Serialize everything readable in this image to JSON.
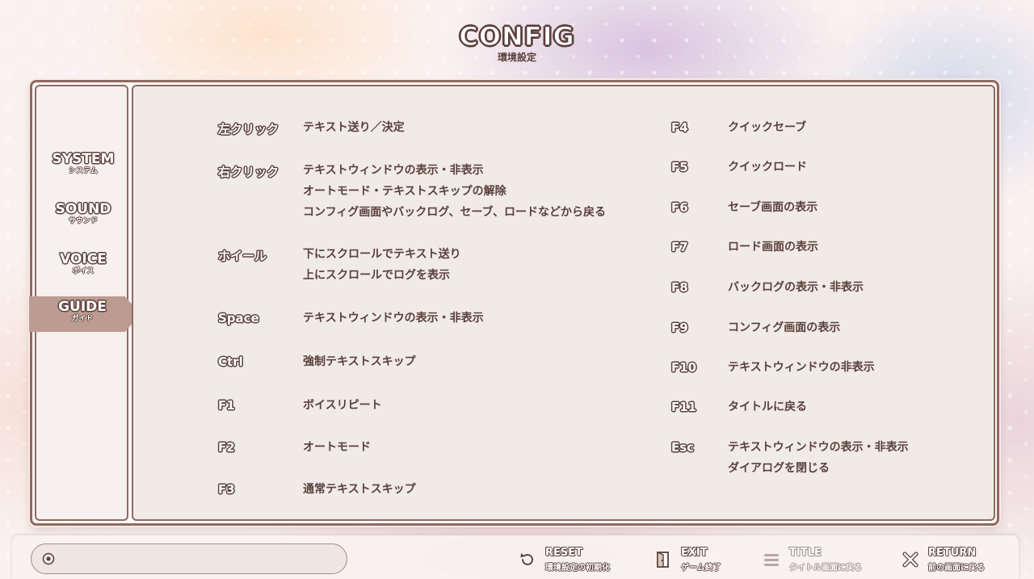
{
  "header": {
    "title": "CONFIG",
    "subtitle": "環境設定"
  },
  "sidebar": {
    "items": [
      {
        "label": "SYSTEM",
        "sub": "システム",
        "active": false
      },
      {
        "label": "SOUND",
        "sub": "サウンド",
        "active": false
      },
      {
        "label": "VOICE",
        "sub": "ボイス",
        "active": false
      },
      {
        "label": "GUIDE",
        "sub": "ガイド",
        "active": true
      }
    ]
  },
  "guide": {
    "left": [
      {
        "key": "左クリック",
        "lines": [
          "テキスト送り／決定"
        ]
      },
      {
        "key": "右クリック",
        "lines": [
          "テキストウィンドウの表示・非表示",
          "オートモード・テキストスキップの解除",
          "コンフィグ画面やバックログ、セーブ、ロードなどから戻る"
        ]
      },
      {
        "key": "ホイール",
        "lines": [
          "下にスクロールでテキスト送り",
          "上にスクロールでログを表示"
        ]
      },
      {
        "key": "Space",
        "lines": [
          "テキストウィンドウの表示・非表示"
        ]
      },
      {
        "key": "Ctrl",
        "lines": [
          "強制テキストスキップ"
        ]
      },
      {
        "key": "F1",
        "lines": [
          "ボイスリピート"
        ]
      },
      {
        "key": "F2",
        "lines": [
          "オートモード"
        ]
      },
      {
        "key": "F3",
        "lines": [
          "通常テキストスキップ"
        ]
      }
    ],
    "right": [
      {
        "key": "F4",
        "lines": [
          "クイックセーブ"
        ]
      },
      {
        "key": "F5",
        "lines": [
          "クイックロード"
        ]
      },
      {
        "key": "F6",
        "lines": [
          "セーブ画面の表示"
        ]
      },
      {
        "key": "F7",
        "lines": [
          "ロード画面の表示"
        ]
      },
      {
        "key": "F8",
        "lines": [
          "バックログの表示・非表示"
        ]
      },
      {
        "key": "F9",
        "lines": [
          "コンフィグ画面の表示"
        ]
      },
      {
        "key": "F10",
        "lines": [
          "テキストウィンドウの非表示"
        ]
      },
      {
        "key": "F11",
        "lines": [
          "タイトルに戻る"
        ]
      },
      {
        "key": "Esc",
        "lines": [
          "テキストウィンドウの表示・非表示",
          "ダイアログを閉じる"
        ]
      }
    ]
  },
  "bottom": {
    "reset": {
      "label": "RESET",
      "sub": "環境設定の初期化",
      "icon": "reset-icon"
    },
    "exit": {
      "label": "EXIT",
      "sub": "ゲーム終了",
      "icon": "exit-door-icon"
    },
    "title": {
      "label": "TITLE",
      "sub": "タイトル画面に戻る",
      "icon": "menu-lines-icon"
    },
    "return": {
      "label": "RETURN",
      "sub": "前の画面に戻る",
      "icon": "close-icon"
    }
  }
}
